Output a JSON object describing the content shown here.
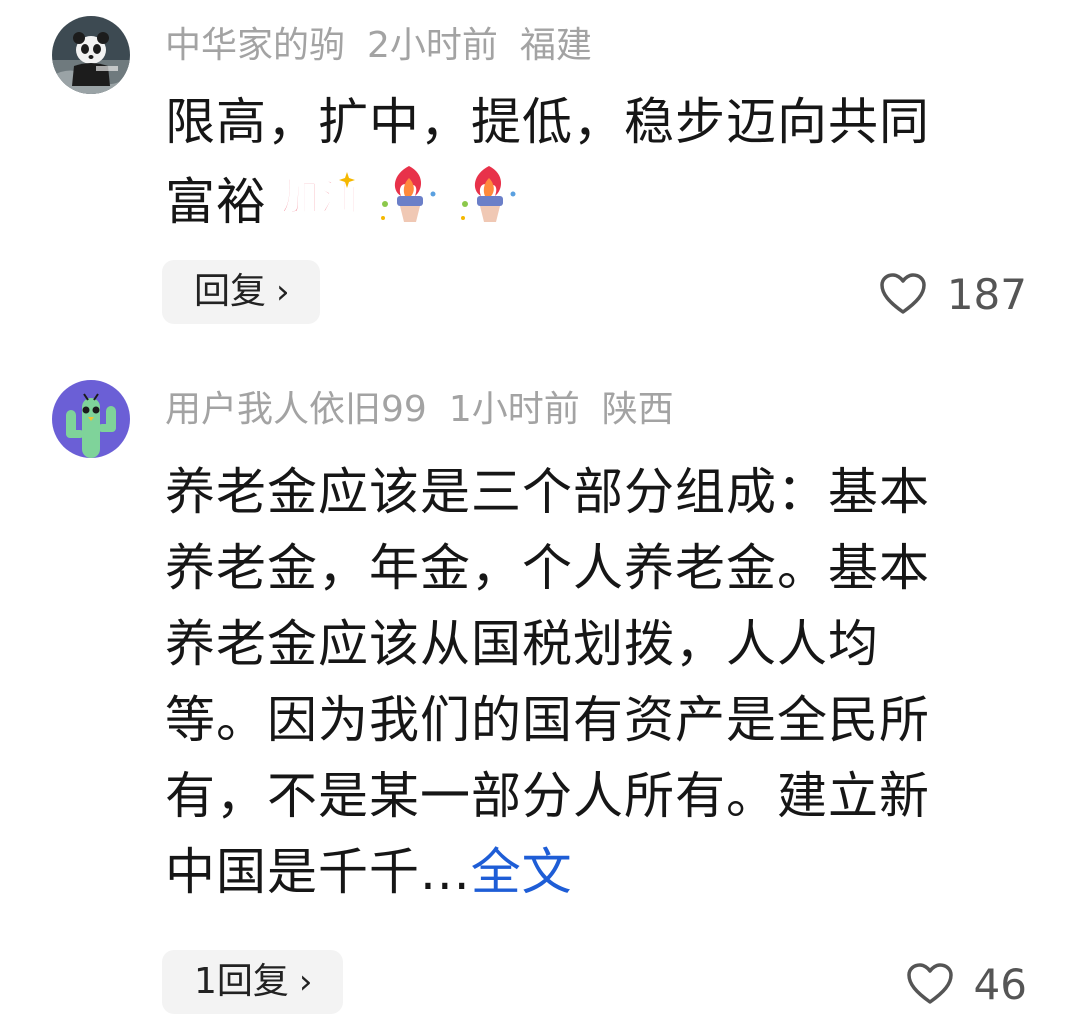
{
  "comments": [
    {
      "username": "中华家的驹",
      "time": "2小时前",
      "location": "福建",
      "lines": [
        "限高，扩中，提低，稳步迈向共同",
        "富裕"
      ],
      "emoji_text": "加油",
      "icons": [
        "avatar-panda-icon",
        "jiayou-sticker-icon",
        "torch-icon",
        "torch-icon"
      ],
      "reply_label": "回复",
      "like_count": "187"
    },
    {
      "username": "用户我人依旧99",
      "time": "1小时前",
      "location": "陕西",
      "lines": [
        "养老金应该是三个部分组成：基本",
        "养老金，年金，个人养老金。基本",
        "养老金应该从国税划拨，人人均",
        "等。因为我们的国有资产是全民所",
        "有，不是某一部分人所有。建立新",
        "中国是千千..."
      ],
      "more_label": "全文",
      "icons": [
        "avatar-cactus-icon"
      ],
      "reply_label": "1回复",
      "like_count": "46"
    }
  ],
  "colors": {
    "meta": "#a3a3a3",
    "text": "#161616",
    "link": "#1e5dd6",
    "reply_bg": "#f3f3f3"
  }
}
